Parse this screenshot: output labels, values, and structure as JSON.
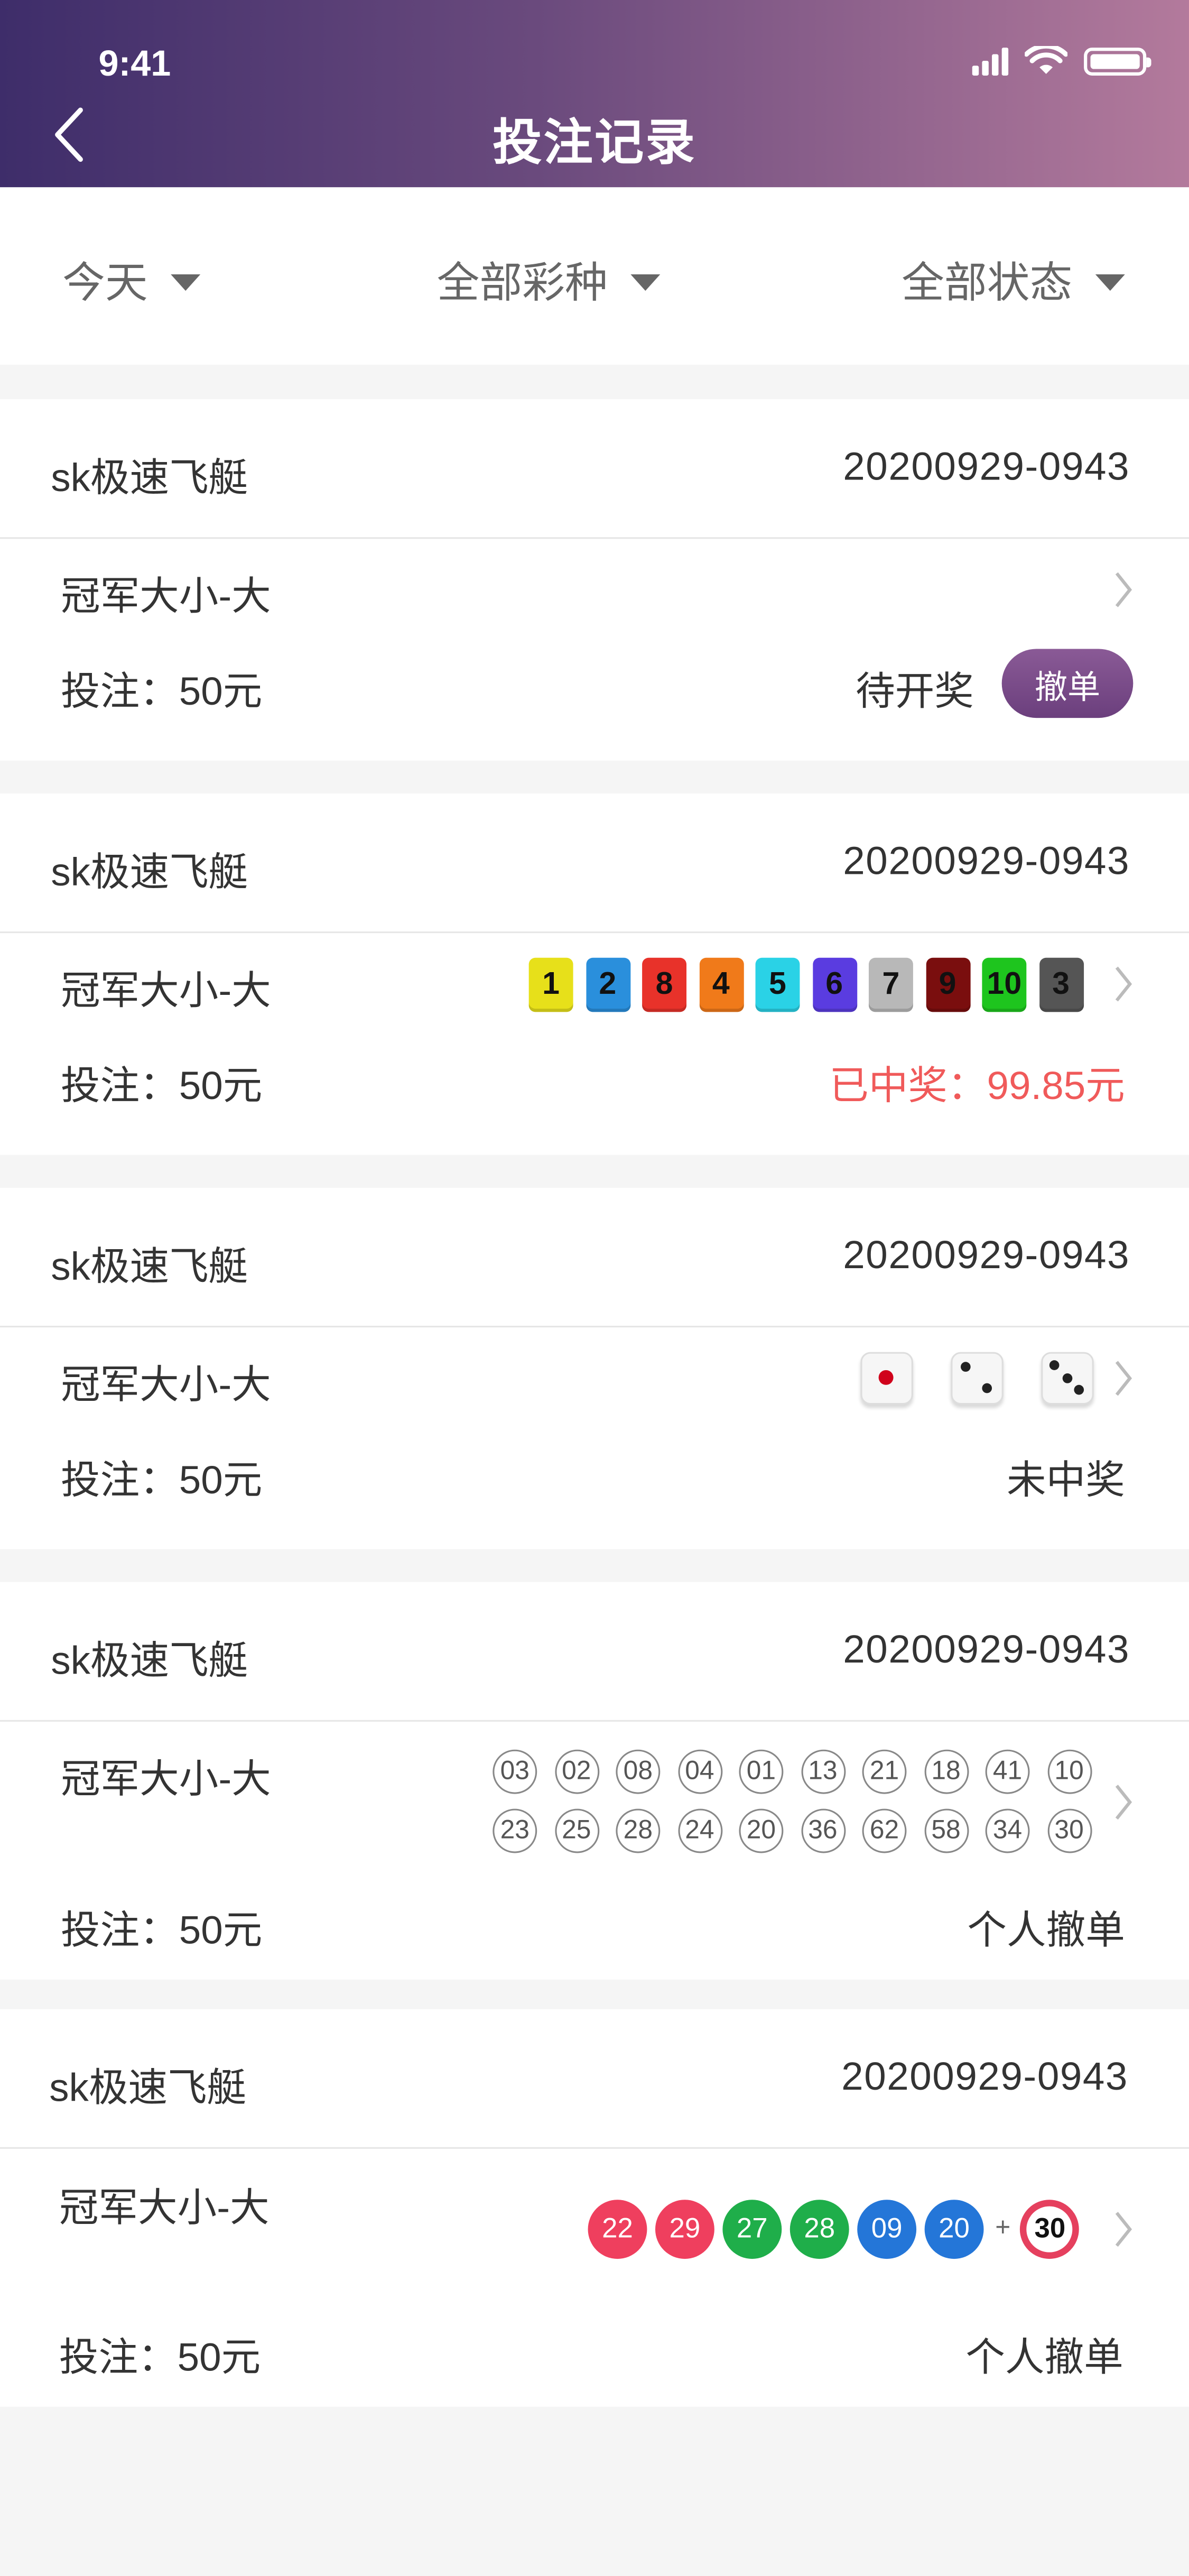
{
  "status_bar": {
    "time": "9:41"
  },
  "header": {
    "title": "投注记录"
  },
  "filters": [
    {
      "label": "今天"
    },
    {
      "label": "全部彩种"
    },
    {
      "label": "全部状态"
    }
  ],
  "colors": {
    "header_start": "#3e2d6a",
    "header_end": "#b37a9c",
    "win": "#f05a5a",
    "cancel_button": "#7a4b8a"
  },
  "records": [
    {
      "lottery": "sk极速飞艇",
      "issue": "20200929-0943",
      "play": "冠军大小-大",
      "stake": "投注：50元",
      "status": "待开奖",
      "action": "撤单"
    },
    {
      "lottery": "sk极速飞艇",
      "issue": "20200929-0943",
      "play": "冠军大小-大",
      "stake": "投注：50元",
      "status": "已中奖：99.85元",
      "result_squares": [
        {
          "n": "1",
          "c": "#e7e01a"
        },
        {
          "n": "2",
          "c": "#2a8fdc"
        },
        {
          "n": "8",
          "c": "#e8322a"
        },
        {
          "n": "4",
          "c": "#f07a1a"
        },
        {
          "n": "5",
          "c": "#2ad2e6"
        },
        {
          "n": "6",
          "c": "#5a3ce0"
        },
        {
          "n": "7",
          "c": "#b8b8b8"
        },
        {
          "n": "9",
          "c": "#7a0e0e"
        },
        {
          "n": "10",
          "c": "#1ec51e"
        },
        {
          "n": "3",
          "c": "#555555"
        }
      ]
    },
    {
      "lottery": "sk极速飞艇",
      "issue": "20200929-0943",
      "play": "冠军大小-大",
      "stake": "投注：50元",
      "status": "未中奖",
      "dice": [
        1,
        2,
        3
      ]
    },
    {
      "lottery": "sk极速飞艇",
      "issue": "20200929-0943",
      "play": "冠军大小-大",
      "stake": "投注：50元",
      "status": "个人撤单",
      "numbers_row1": [
        "03",
        "02",
        "08",
        "04",
        "01",
        "13",
        "21",
        "18",
        "41",
        "10"
      ],
      "numbers_row2": [
        "23",
        "25",
        "28",
        "24",
        "20",
        "36",
        "62",
        "58",
        "34",
        "30"
      ]
    },
    {
      "lottery": "sk极速飞艇",
      "issue": "20200929-0943",
      "play": "冠军大小-大",
      "stake": "投注：50元",
      "status": "个人撤单",
      "balls": [
        {
          "n": "22",
          "c": "#ef3f5e"
        },
        {
          "n": "29",
          "c": "#ef3f5e"
        },
        {
          "n": "27",
          "c": "#1fae4a"
        },
        {
          "n": "28",
          "c": "#1fae4a"
        },
        {
          "n": "09",
          "c": "#2476d8"
        },
        {
          "n": "20",
          "c": "#2476d8"
        }
      ],
      "plus": "+",
      "special_ball": "30"
    }
  ]
}
